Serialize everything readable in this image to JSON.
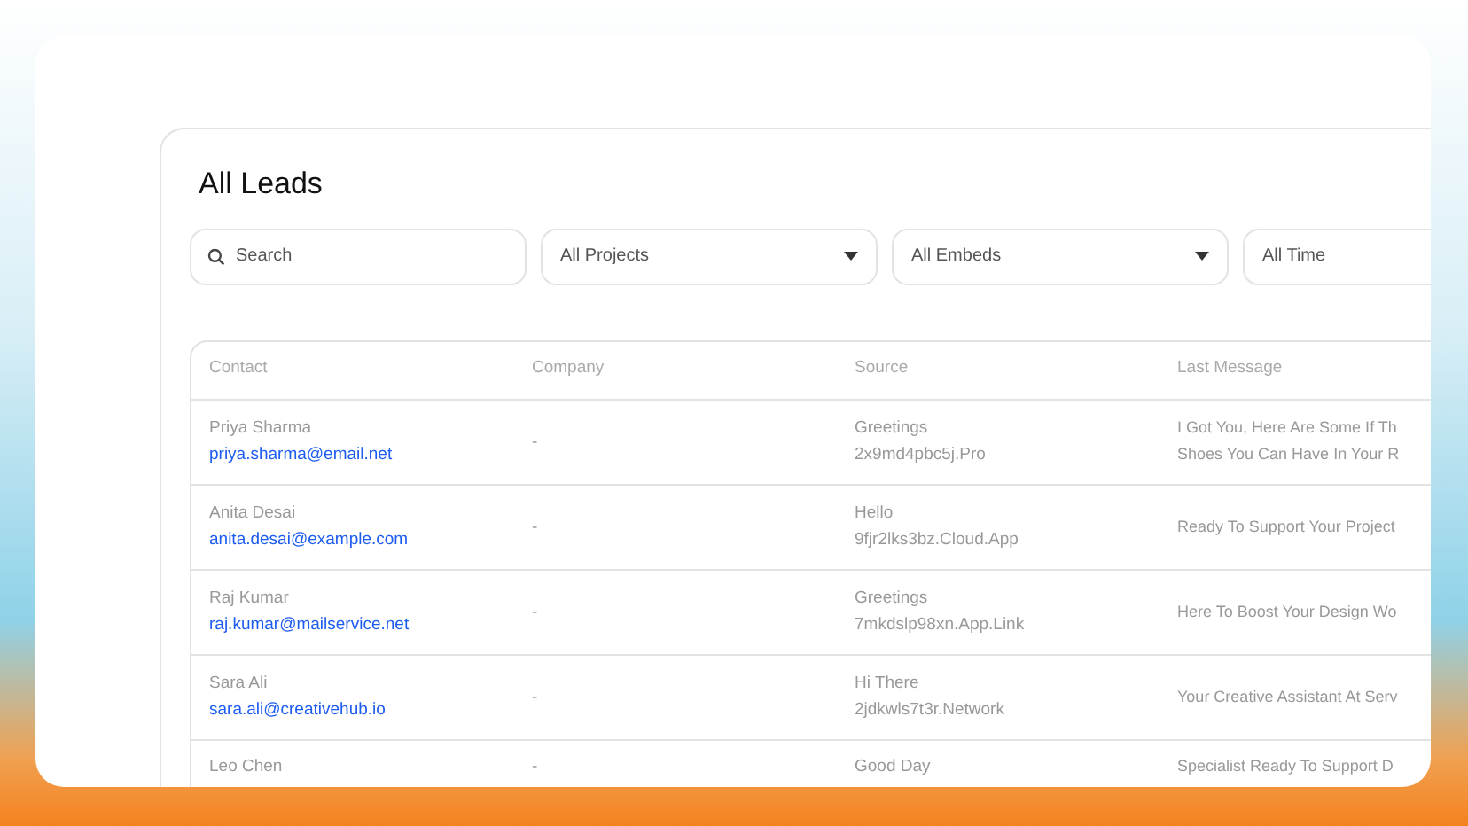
{
  "title": "All Leads",
  "filters": [
    {
      "kind": "search",
      "placeholder": "Search"
    },
    {
      "kind": "dropdown",
      "value": "All Projects",
      "caret": true
    },
    {
      "kind": "dropdown",
      "value": "All Embeds",
      "caret": true
    },
    {
      "kind": "dropdown",
      "value": "All Time",
      "caret": false
    }
  ],
  "table": {
    "columns": [
      "Contact",
      "Company",
      "Source",
      "Last Message"
    ],
    "rows": [
      {
        "name": "Priya Sharma",
        "email": "priya.sharma@email.net",
        "company": "-",
        "source_title": "Greetings",
        "source_link": "2x9md4pbc5j.Pro",
        "last_message": [
          "I Got You, Here Are Some If Th",
          "Shoes You Can Have In Your R"
        ]
      },
      {
        "name": "Anita Desai",
        "email": "anita.desai@example.com",
        "company": "-",
        "source_title": "Hello",
        "source_link": "9fjr2lks3bz.Cloud.App",
        "last_message": [
          "Ready To Support Your Project"
        ]
      },
      {
        "name": "Raj Kumar",
        "email": "raj.kumar@mailservice.net",
        "company": "-",
        "source_title": "Greetings",
        "source_link": "7mkdslp98xn.App.Link",
        "last_message": [
          "Here To Boost Your Design Wo"
        ]
      },
      {
        "name": "Sara Ali",
        "email": "sara.ali@creativehub.io",
        "company": "-",
        "source_title": "Hi There",
        "source_link": "2jdkwls7t3r.Network",
        "last_message": [
          "Your Creative Assistant At Serv"
        ]
      },
      {
        "name": "Leo Chen",
        "company": "-",
        "source_title": "Good Day",
        "last_message": [
          "Specialist Ready To Support D"
        ]
      }
    ]
  }
}
